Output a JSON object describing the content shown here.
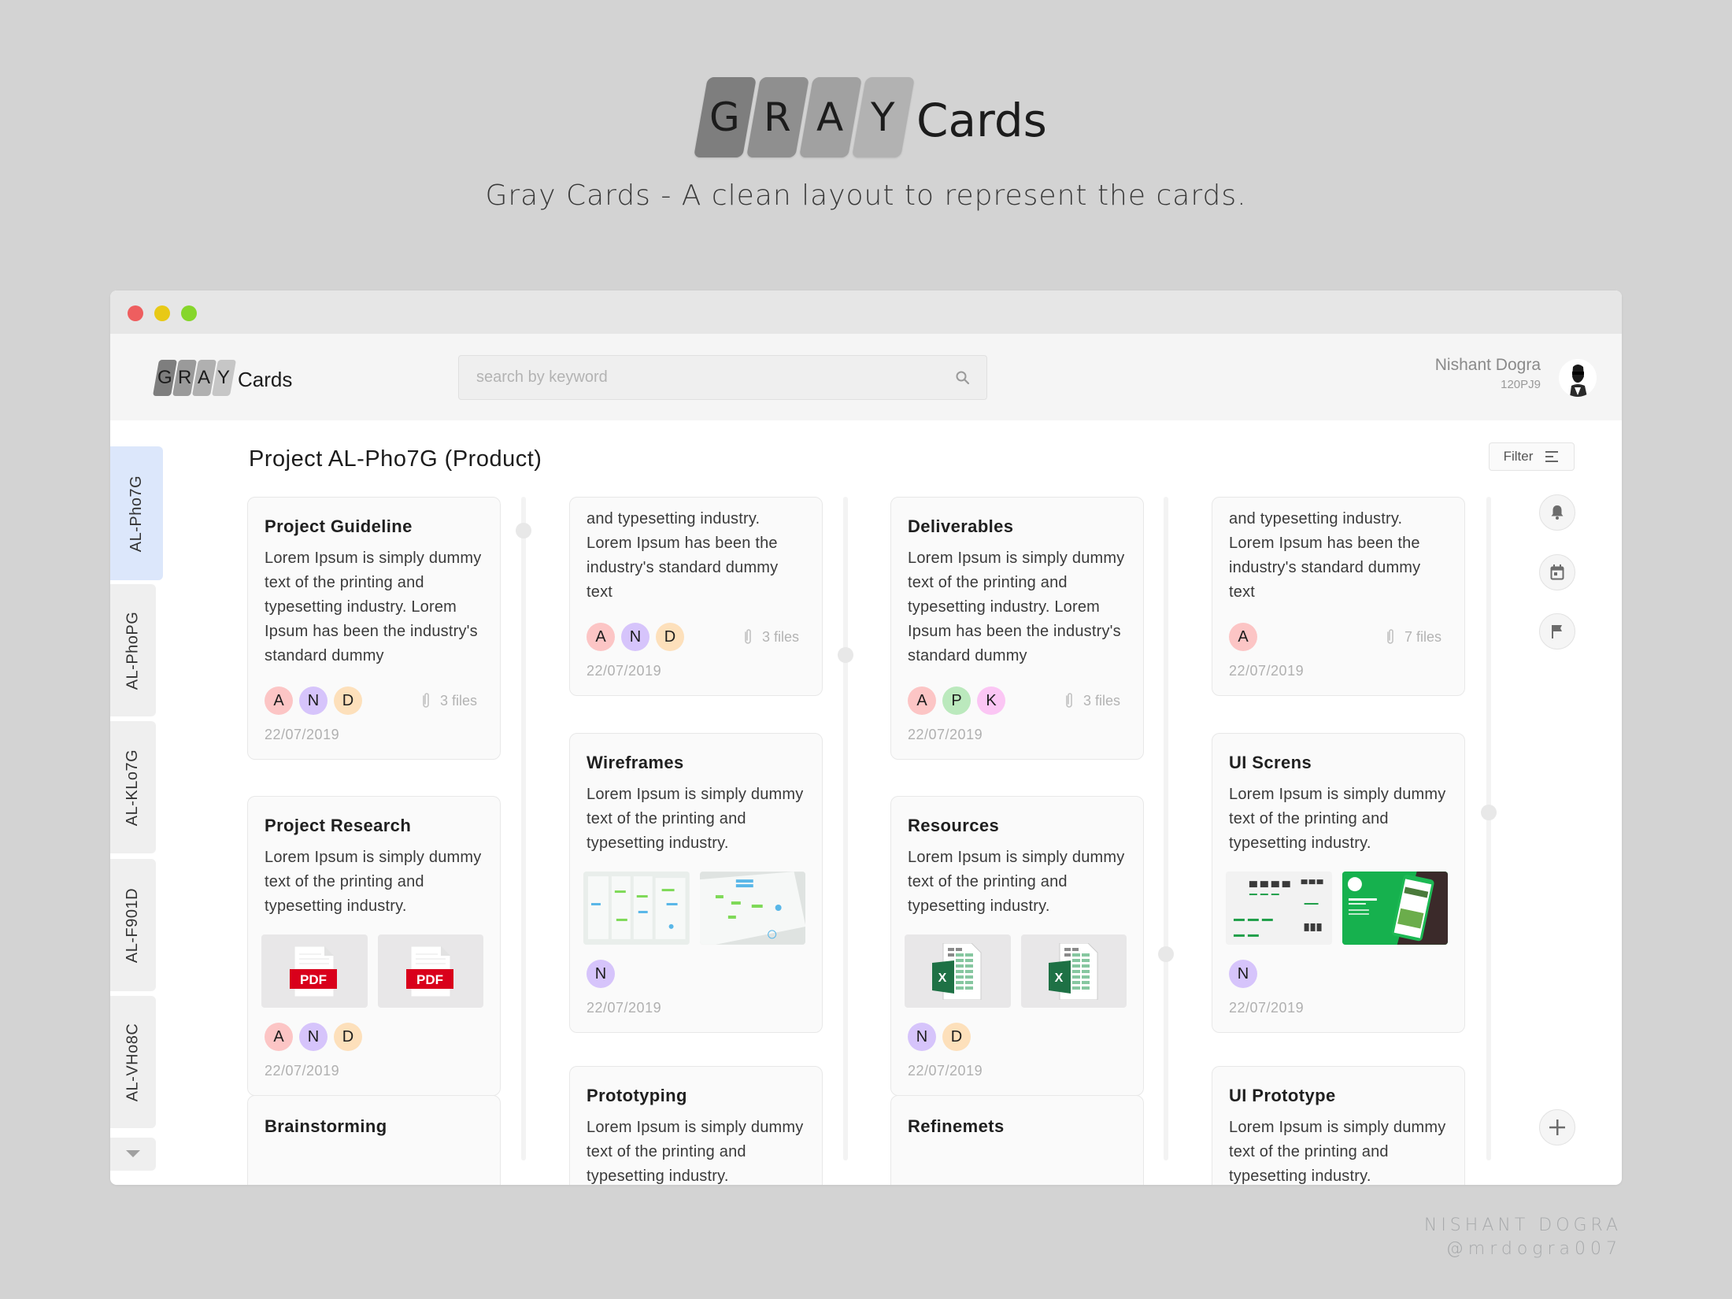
{
  "hero": {
    "logo_letters": [
      "G",
      "R",
      "A",
      "Y"
    ],
    "logo_word": "Cards",
    "subtitle": "Gray Cards - A clean layout to represent the cards."
  },
  "window": {
    "traffic_lights": {
      "close": "#ee5e5f",
      "minimize": "#e8c916",
      "maximize": "#86d62b"
    }
  },
  "header": {
    "logo_letters": [
      "G",
      "R",
      "A",
      "Y"
    ],
    "logo_word": "Cards",
    "search_placeholder": "search by keyword",
    "search_value": "",
    "user_name": "Nishant Dogra",
    "user_id": "120PJ9"
  },
  "sidebar": {
    "tabs": [
      {
        "label": "AL-Pho7G",
        "active": true
      },
      {
        "label": "AL-PhoPG",
        "active": false
      },
      {
        "label": "AL-KLo7G",
        "active": false
      },
      {
        "label": "AL-F901D",
        "active": false
      },
      {
        "label": "AL-VHo8C",
        "active": false
      }
    ],
    "more_icon": "caret-down-icon"
  },
  "main": {
    "title": "Project AL-Pho7G (Product)",
    "filter_label": "Filter",
    "columns": [
      {
        "cards": [
          {
            "title": "Project Guideline",
            "text": "Lorem Ipsum is simply dummy text of the printing and typesetting industry. Lorem Ipsum has been the industry's standard dummy",
            "avatars": [
              "A",
              "N",
              "D"
            ],
            "files": "3 files",
            "date": "22/07/2019"
          },
          {
            "title": "Project Research",
            "text": "Lorem Ipsum is simply dummy text of the printing and typesetting industry.",
            "attachments": [
              "PDF",
              "PDF"
            ],
            "avatars": [
              "A",
              "N",
              "D"
            ],
            "date": "22/07/2019"
          },
          {
            "title": "Brainstorming"
          }
        ]
      },
      {
        "cards": [
          {
            "text": "and typesetting industry. Lorem Ipsum has been the industry's standard dummy text",
            "avatars": [
              "A",
              "N",
              "D"
            ],
            "files": "3 files",
            "date": "22/07/2019"
          },
          {
            "title": "Wireframes",
            "text": "Lorem Ipsum is simply dummy text of the printing and typesetting industry.",
            "attachments": [
              "wireframe-photo",
              "wireframe-photo"
            ],
            "avatars": [
              "N"
            ],
            "date": "22/07/2019"
          },
          {
            "title": "Prototyping",
            "text": "Lorem Ipsum is simply dummy text of the printing and typesetting industry."
          }
        ]
      },
      {
        "cards": [
          {
            "title": "Deliverables",
            "text": "Lorem Ipsum is simply dummy text of the printing and typesetting industry. Lorem Ipsum has been the industry's standard dummy",
            "avatars": [
              "A",
              "P",
              "K"
            ],
            "files": "3 files",
            "date": "22/07/2019"
          },
          {
            "title": "Resources",
            "text": "Lorem Ipsum is simply dummy text of the printing and typesetting industry.",
            "attachments": [
              "X",
              "X"
            ],
            "avatars": [
              "N",
              "D"
            ],
            "date": "22/07/2019"
          },
          {
            "title": "Refinemets"
          }
        ]
      },
      {
        "cards": [
          {
            "text": "and typesetting industry. Lorem Ipsum has been the industry's standard dummy text",
            "avatars": [
              "A"
            ],
            "files": "7 files",
            "date": "22/07/2019"
          },
          {
            "title": "UI Screns",
            "text": "Lorem Ipsum is simply dummy text of the printing and typesetting industry.",
            "attachments": [
              "ui-screens-image",
              "app-design-image"
            ],
            "avatars": [
              "N"
            ],
            "date": "22/07/2019"
          },
          {
            "title": "UI Prototype",
            "text": "Lorem Ipsum is simply dummy text of the printing and typesetting industry."
          }
        ]
      }
    ],
    "avatar_colors": {
      "A": "#fcc5c5",
      "N": "#d6c4fb",
      "D": "#fde0bb",
      "P": "#bbe9bd",
      "K": "#fbc6f4"
    },
    "actions": [
      "bell-icon",
      "calendar-icon",
      "flag-icon"
    ],
    "add_icon": "plus-icon"
  },
  "footer": {
    "name": "NISHANT DOGRA",
    "handle": "@mrdogra007"
  }
}
